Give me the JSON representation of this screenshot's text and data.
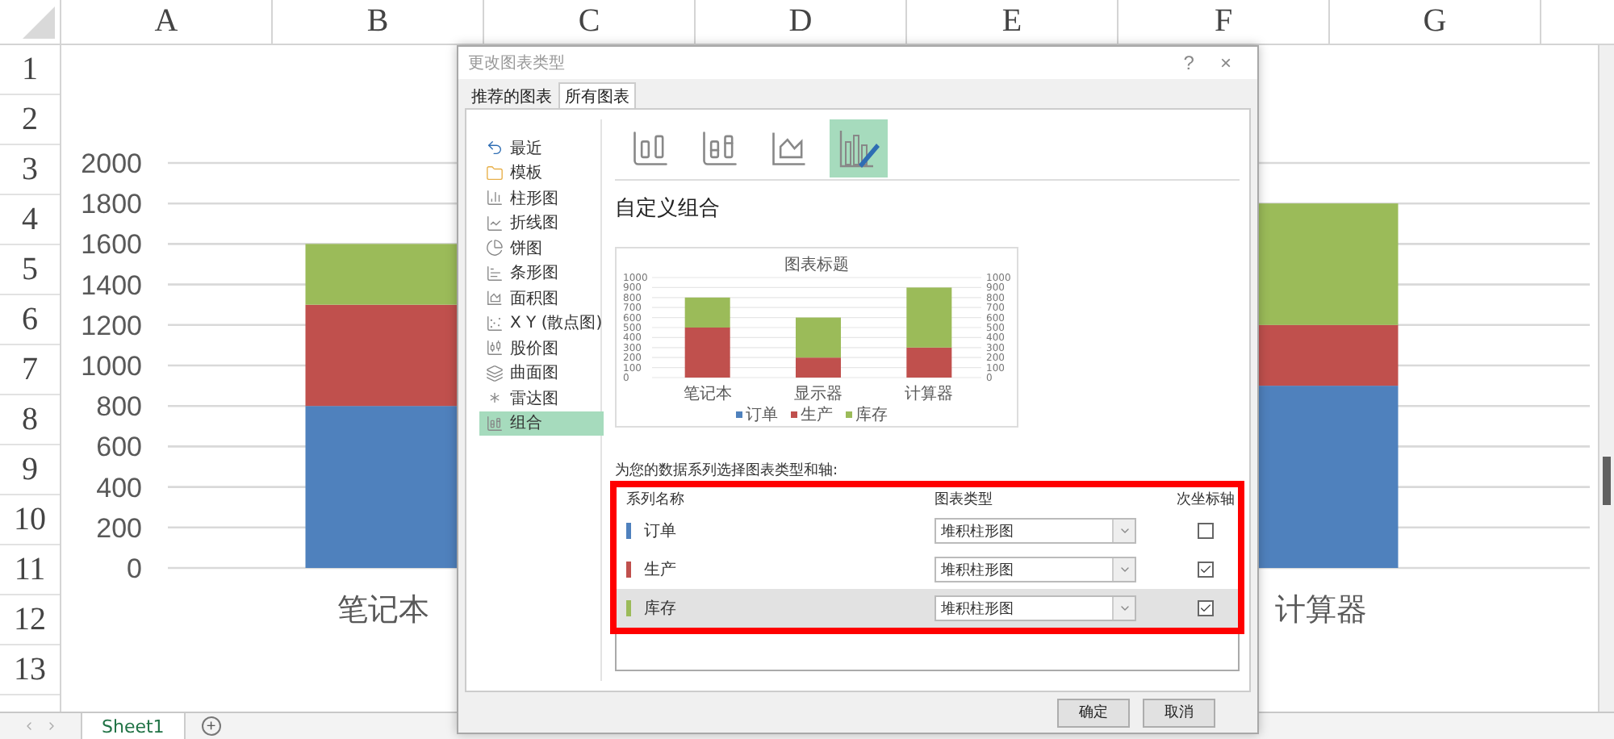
{
  "sheet": {
    "columns": [
      "A",
      "B",
      "C",
      "D",
      "E",
      "F",
      "G"
    ],
    "rows": [
      "1",
      "2",
      "3",
      "4",
      "5",
      "6",
      "7",
      "8",
      "9",
      "10",
      "11",
      "12",
      "13"
    ],
    "chart": {
      "chart_data": {
        "type": "bar",
        "stacked": true,
        "grid": true,
        "categories": [
          "笔记本",
          "计算器"
        ],
        "ylim": [
          0,
          2000
        ],
        "yticks": [
          0,
          200,
          400,
          600,
          800,
          1000,
          1200,
          1400,
          1600,
          1800,
          2000
        ],
        "series": [
          {
            "color": "#4f81bd",
            "values": [
              800,
              900
            ]
          },
          {
            "color": "#c0504d",
            "values": [
              500,
              300
            ]
          },
          {
            "color": "#9bbb59",
            "values": [
              300,
              600
            ]
          }
        ]
      }
    },
    "tabs": [
      {
        "label": "Sheet1",
        "selected": true
      }
    ],
    "add_sheet": "+"
  },
  "dialog": {
    "title": "更改图表类型",
    "help": "?",
    "close": "×",
    "tabs": [
      {
        "label": "推荐的图表",
        "selected": false
      },
      {
        "label": "所有图表",
        "selected": true
      }
    ],
    "chart_types": [
      {
        "label": "最近",
        "selected": false
      },
      {
        "label": "模板",
        "selected": false
      },
      {
        "label": "柱形图",
        "selected": false
      },
      {
        "label": "折线图",
        "selected": false
      },
      {
        "label": "饼图",
        "selected": false
      },
      {
        "label": "条形图",
        "selected": false
      },
      {
        "label": "面积图",
        "selected": false
      },
      {
        "label": "X Y (散点图)",
        "selected": false
      },
      {
        "label": "股价图",
        "selected": false
      },
      {
        "label": "曲面图",
        "selected": false
      },
      {
        "label": "雷达图",
        "selected": false
      },
      {
        "label": "组合",
        "selected": true
      }
    ],
    "subtypes": [
      {
        "selected": false
      },
      {
        "selected": false
      },
      {
        "selected": false
      },
      {
        "selected": true
      }
    ],
    "heading": "自定义组合",
    "preview": {
      "chart_data": {
        "type": "bar",
        "stacked": true,
        "grid": true,
        "legend": true,
        "title": "图表标题",
        "categories": [
          "笔记本",
          "显示器",
          "计算器"
        ],
        "ylim": [
          0,
          1000
        ],
        "yticks": [
          0,
          100,
          200,
          300,
          400,
          500,
          600,
          700,
          800,
          900,
          1000
        ],
        "y2lim": [
          0,
          1000
        ],
        "y2ticks": [
          0,
          100,
          200,
          300,
          400,
          500,
          600,
          700,
          800,
          900,
          1000
        ],
        "series": [
          {
            "name": "订单",
            "color": "#4f81bd",
            "values": [
              null,
              null,
              null
            ]
          },
          {
            "name": "生产",
            "color": "#c0504d",
            "values": [
              500,
              200,
              300
            ]
          },
          {
            "name": "库存",
            "color": "#9bbb59",
            "values": [
              300,
              400,
              600
            ]
          }
        ]
      }
    },
    "instruction": "为您的数据系列选择图表类型和轴:",
    "columns": [
      "系列名称",
      "图表类型",
      "次坐标轴"
    ],
    "series": [
      {
        "name": "订单",
        "color": "#4f81bd",
        "chart_type": "堆积柱形图",
        "secondary_axis": false,
        "selected": false
      },
      {
        "name": "生产",
        "color": "#c0504d",
        "chart_type": "堆积柱形图",
        "secondary_axis": true,
        "selected": false
      },
      {
        "name": "库存",
        "color": "#9bbb59",
        "chart_type": "堆积柱形图",
        "secondary_axis": true,
        "selected": true
      }
    ],
    "buttons": [
      "确定",
      "取消"
    ]
  }
}
